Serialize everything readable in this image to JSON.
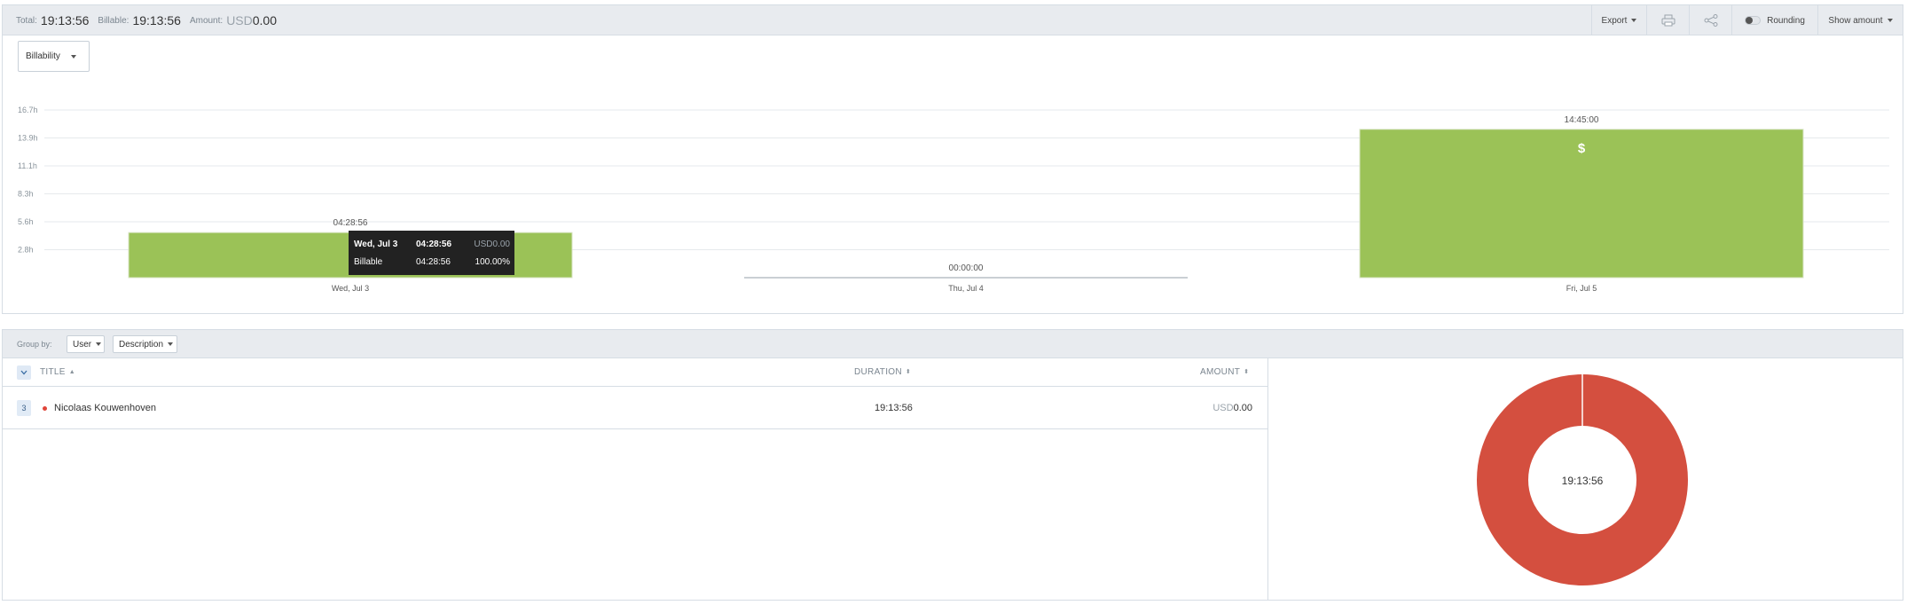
{
  "summary": {
    "total_label": "Total:",
    "total_value": "19:13:56",
    "billable_label": "Billable:",
    "billable_value": "19:13:56",
    "amount_label": "Amount:",
    "amount_currency": "USD",
    "amount_value": "0.00"
  },
  "toolbar": {
    "export_label": "Export",
    "print_icon": "printer-icon",
    "share_icon": "share-icon",
    "rounding_label": "Rounding",
    "rounding_enabled": false,
    "show_amount_label": "Show amount"
  },
  "chart_controls": {
    "billability_label": "Billability"
  },
  "chart_data": {
    "type": "bar",
    "categories": [
      "Wed, Jul 3",
      "Thu, Jul 4",
      "Fri, Jul 5"
    ],
    "values": [
      4.482,
      0,
      14.75
    ],
    "value_labels": [
      "04:28:56",
      "00:00:00",
      "14:45:00"
    ],
    "y_ticks": [
      "2.8h",
      "5.6h",
      "8.3h",
      "11.1h",
      "13.9h",
      "16.7h"
    ],
    "y_tick_values": [
      2.78,
      5.56,
      8.33,
      11.11,
      13.89,
      16.67
    ],
    "ylim": [
      0,
      16.67
    ],
    "bar_color": "#9bc257",
    "bar_icon": "$",
    "grid": true
  },
  "tooltip": {
    "date": "Wed, Jul 3",
    "duration": "04:28:56",
    "currency": "USD",
    "amount": "0.00",
    "type_label": "Billable",
    "type_duration": "04:28:56",
    "percent": "100.00%"
  },
  "group_by": {
    "label": "Group by:",
    "primary": "User",
    "secondary": "Description"
  },
  "table": {
    "columns": {
      "title": "TITLE",
      "duration": "DURATION",
      "amount": "AMOUNT"
    },
    "rows": [
      {
        "count": "3",
        "title": "Nicolaas Kouwenhoven",
        "duration": "19:13:56",
        "currency": "USD",
        "amount": "0.00",
        "color": "#e0453a"
      }
    ]
  },
  "donut": {
    "center_label": "19:13:56",
    "color": "#d44f3f",
    "share": 1.0
  }
}
